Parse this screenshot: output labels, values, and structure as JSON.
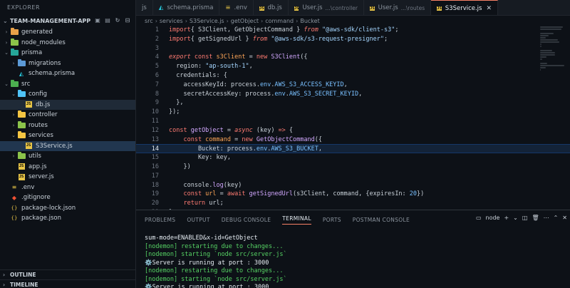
{
  "sidebar": {
    "title": "EXPLORER",
    "project": "TEAM-MANAGEMENT-APP",
    "items": [
      {
        "label": "generated",
        "type": "folder",
        "open": false,
        "color": "#e8a048",
        "depth": 1
      },
      {
        "label": "node_modules",
        "type": "folder",
        "open": false,
        "color": "#8bc34a",
        "depth": 1
      },
      {
        "label": "prisma",
        "type": "folder",
        "open": true,
        "color": "#26a69a",
        "depth": 1
      },
      {
        "label": "migrations",
        "type": "folder",
        "open": false,
        "color": "#5c9ad6",
        "depth": 2
      },
      {
        "label": "schema.prisma",
        "type": "prisma",
        "depth": 2
      },
      {
        "label": "src",
        "type": "folder",
        "open": true,
        "color": "#4caf50",
        "depth": 1
      },
      {
        "label": "config",
        "type": "folder",
        "open": true,
        "color": "#4fc3f7",
        "depth": 2
      },
      {
        "label": "db.js",
        "type": "js",
        "depth": 3,
        "state": "active"
      },
      {
        "label": "controller",
        "type": "folder",
        "open": false,
        "color": "#f4c542",
        "depth": 2
      },
      {
        "label": "routes",
        "type": "folder",
        "open": false,
        "color": "#8bc34a",
        "depth": 2
      },
      {
        "label": "services",
        "type": "folder",
        "open": true,
        "color": "#f4c542",
        "depth": 2
      },
      {
        "label": "S3Service.js",
        "type": "js",
        "depth": 3,
        "state": "selected"
      },
      {
        "label": "utils",
        "type": "folder",
        "open": false,
        "color": "#8bc34a",
        "depth": 2
      },
      {
        "label": "app.js",
        "type": "js",
        "depth": 2
      },
      {
        "label": "server.js",
        "type": "js",
        "depth": 2
      },
      {
        "label": ".env",
        "type": "env",
        "depth": 1
      },
      {
        "label": ".gitignore",
        "type": "git",
        "depth": 1
      },
      {
        "label": "package-lock.json",
        "type": "json",
        "depth": 1
      },
      {
        "label": "package.json",
        "type": "json",
        "depth": 1
      }
    ],
    "outline": "OUTLINE",
    "timeline": "TIMELINE"
  },
  "tabs": [
    {
      "label": "js",
      "type": "js"
    },
    {
      "label": "schema.prisma",
      "type": "prisma"
    },
    {
      "label": ".env",
      "type": "env"
    },
    {
      "label": "db.js",
      "type": "js"
    },
    {
      "label": "User.js",
      "desc": "...\\controller",
      "type": "js"
    },
    {
      "label": "User.js",
      "desc": "...\\routes",
      "type": "js"
    },
    {
      "label": "S3Service.js",
      "type": "js",
      "active": true
    }
  ],
  "breadcrumb": [
    "src",
    "services",
    "S3Service.js",
    "getObject",
    "command",
    "Bucket"
  ],
  "code": [
    {
      "n": "1",
      "t": [
        [
          "kw",
          "import"
        ],
        [
          "",
          "{ S3Client, GetObjectCommand } "
        ],
        [
          "it",
          "from"
        ],
        [
          "str",
          " \"@aws-sdk/client-s3\""
        ],
        [
          "",
          ";"
        ]
      ]
    },
    {
      "n": "2",
      "t": [
        [
          "kw",
          "import"
        ],
        [
          "",
          "{ getSignedUrl } "
        ],
        [
          "it",
          "from"
        ],
        [
          "str",
          " \"@aws-sdk/s3-request-presigner\""
        ],
        [
          "",
          ";"
        ]
      ]
    },
    {
      "n": "3",
      "t": []
    },
    {
      "n": "4",
      "t": [
        [
          "it",
          "export"
        ],
        [
          "kw",
          " const"
        ],
        [
          "var",
          " s3Client"
        ],
        [
          "",
          " = "
        ],
        [
          "kw",
          "new"
        ],
        [
          "fn",
          " S3Client"
        ],
        [
          "",
          "({"
        ]
      ]
    },
    {
      "n": "5",
      "t": [
        [
          "",
          "  region: "
        ],
        [
          "str",
          "\"ap-south-1\""
        ],
        [
          "",
          ","
        ]
      ]
    },
    {
      "n": "6",
      "t": [
        [
          "",
          "  credentials: {"
        ]
      ]
    },
    {
      "n": "7",
      "t": [
        [
          "",
          "    accessKeyId: process."
        ],
        [
          "prop",
          "env"
        ],
        [
          "",
          "."
        ],
        [
          "cn",
          "AWS_S3_ACCESS_KEYID"
        ],
        [
          "",
          ","
        ]
      ]
    },
    {
      "n": "8",
      "t": [
        [
          "",
          "    secretAccessKey: process."
        ],
        [
          "prop",
          "env"
        ],
        [
          "",
          "."
        ],
        [
          "cn",
          "AWS_S3_SECRET_KEYID"
        ],
        [
          "",
          ","
        ]
      ]
    },
    {
      "n": "9",
      "t": [
        [
          "",
          "  },"
        ]
      ]
    },
    {
      "n": "10",
      "t": [
        [
          "",
          "});"
        ]
      ]
    },
    {
      "n": "11",
      "t": []
    },
    {
      "n": "12",
      "t": [
        [
          "kw",
          "const"
        ],
        [
          "fn",
          " getObject"
        ],
        [
          "",
          " = "
        ],
        [
          "it",
          "async"
        ],
        [
          "",
          " (key) "
        ],
        [
          "kw",
          "=>"
        ],
        [
          "",
          " {"
        ]
      ]
    },
    {
      "n": "13",
      "t": [
        [
          "kw",
          "    const"
        ],
        [
          "var",
          " command"
        ],
        [
          "",
          " = "
        ],
        [
          "kw",
          "new"
        ],
        [
          "fn",
          " GetObjectCommand"
        ],
        [
          "",
          "({"
        ]
      ]
    },
    {
      "n": "14",
      "t": [
        [
          "",
          "        Bucket: process."
        ],
        [
          "prop",
          "env"
        ],
        [
          "",
          "."
        ],
        [
          "cn",
          "AWS_S3_BUCKET"
        ],
        [
          "",
          ","
        ]
      ],
      "current": true
    },
    {
      "n": "15",
      "t": [
        [
          "",
          "        Key: key,"
        ]
      ]
    },
    {
      "n": "16",
      "t": [
        [
          "",
          "    })"
        ]
      ]
    },
    {
      "n": "17",
      "t": []
    },
    {
      "n": "18",
      "t": [
        [
          "",
          "    console."
        ],
        [
          "fn",
          "log"
        ],
        [
          "",
          "(key)"
        ]
      ]
    },
    {
      "n": "19",
      "t": [
        [
          "kw",
          "    const"
        ],
        [
          "var",
          " url"
        ],
        [
          "",
          " = "
        ],
        [
          "kw",
          "await"
        ],
        [
          "fn",
          " getSignedUrl"
        ],
        [
          "",
          "(s3Client, command, {expiresIn: "
        ],
        [
          "cn",
          "20"
        ],
        [
          "",
          "})"
        ]
      ]
    },
    {
      "n": "20",
      "t": [
        [
          "kw",
          "    return"
        ],
        [
          "",
          " url;"
        ]
      ]
    },
    {
      "n": "21",
      "t": [
        [
          "",
          "};"
        ]
      ]
    }
  ],
  "panel": {
    "tabs": [
      "PROBLEMS",
      "OUTPUT",
      "DEBUG CONSOLE",
      "TERMINAL",
      "PORTS",
      "POSTMAN CONSOLE"
    ],
    "active_tab": "TERMINAL",
    "shell": "node",
    "terminal": [
      {
        "text": "sum-mode=ENABLED&x-id=GetObject",
        "color": "white"
      },
      {
        "text": "[nodemon] restarting due to changes...",
        "color": "green"
      },
      {
        "text": "[nodemon] starting `node src/server.js`",
        "color": "green"
      },
      {
        "text": "⚙️Server is running at port : 3000",
        "color": "white"
      },
      {
        "text": "[nodemon] restarting due to changes...",
        "color": "green"
      },
      {
        "text": "[nodemon] starting `node src/server.js`",
        "color": "green"
      },
      {
        "text": "⚙️Server is running at port : 3000",
        "color": "white"
      }
    ]
  }
}
